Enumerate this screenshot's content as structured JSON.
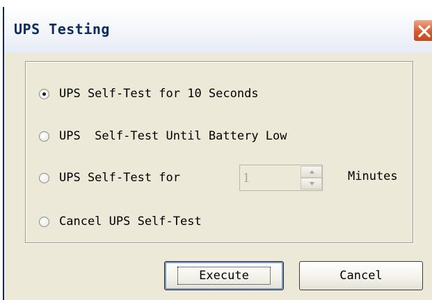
{
  "window": {
    "title": "UPS Testing"
  },
  "options": [
    {
      "label": "UPS Self-Test for 10 Seconds",
      "selected": true
    },
    {
      "label": "UPS  Self-Test Until Battery Low",
      "selected": false
    },
    {
      "label": "UPS Self-Test for",
      "selected": false
    },
    {
      "label": "Cancel UPS Self-Test",
      "selected": false
    }
  ],
  "spinner": {
    "value": "1",
    "enabled": false
  },
  "minutes_label": "Minutes",
  "buttons": {
    "execute": "Execute",
    "cancel": "Cancel"
  },
  "icons": {
    "close": "close-icon",
    "spin_up": "arrow-up-icon",
    "spin_down": "arrow-down-icon"
  },
  "colors": {
    "title_text": "#0b2d63",
    "close_button": "#d85a2e",
    "dialog_bg": "#ece9d8"
  }
}
